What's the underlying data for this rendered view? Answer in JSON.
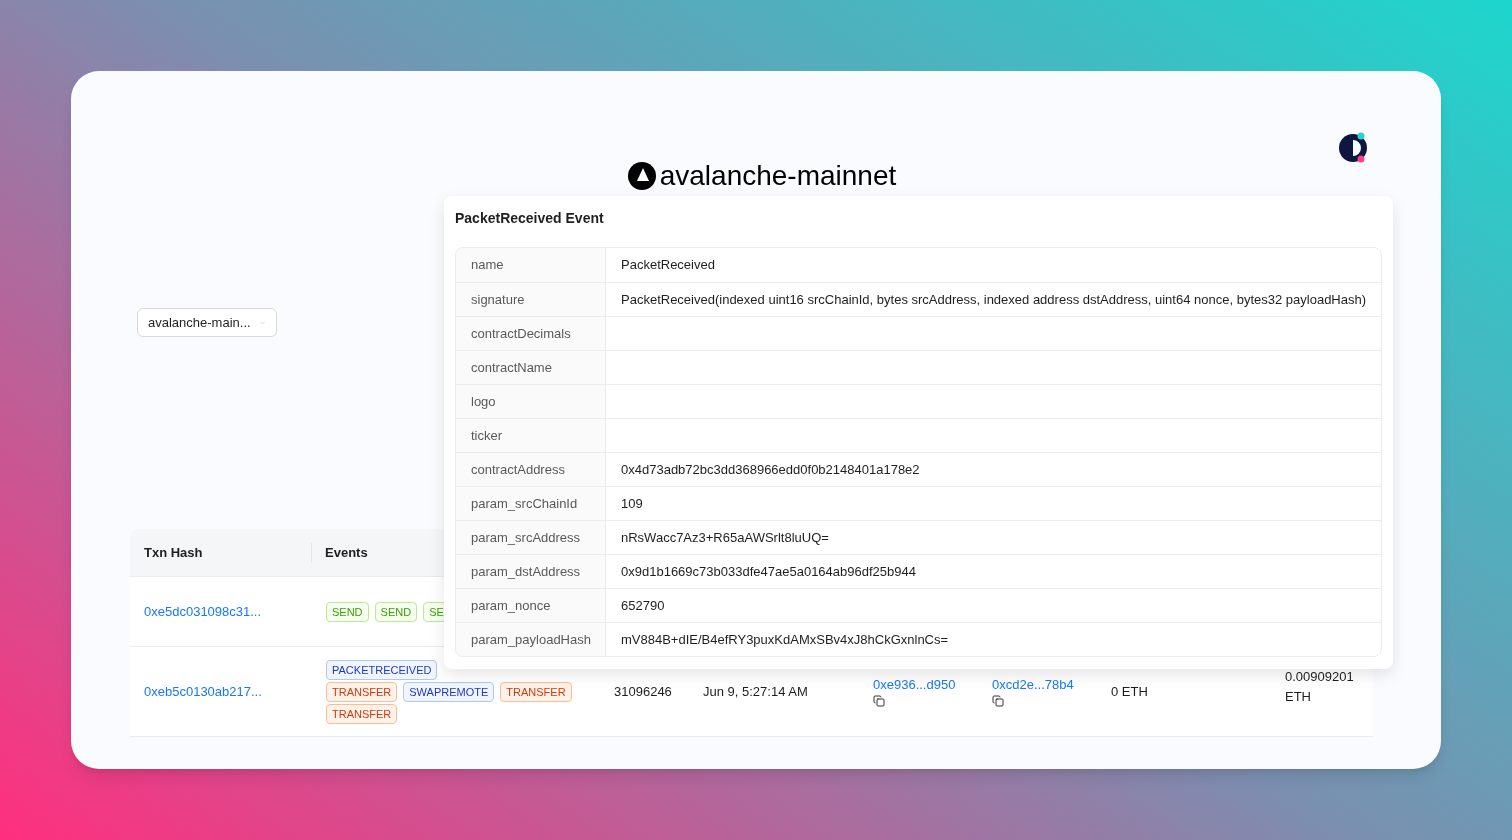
{
  "heading": "avalanche-mainnet",
  "network_select": {
    "value": "avalanche-main..."
  },
  "table": {
    "columns": [
      "Txn Hash",
      "Events"
    ],
    "rows": [
      {
        "txn_hash": "0xe5dc031098c31...",
        "event_lines": [
          [
            {
              "label": "SEND",
              "color": "#389e0d"
            },
            {
              "label": "SEND",
              "color": "#389e0d"
            },
            {
              "label": "SE",
              "color": "#389e0d"
            }
          ]
        ]
      },
      {
        "txn_hash": "0xeb5c0130ab217...",
        "event_lines": [
          [
            {
              "label": "PACKETRECEIVED",
              "color": "#1d39c4"
            }
          ],
          [
            {
              "label": "TRANSFER",
              "color": "#d4380d"
            },
            {
              "label": "SWAPREMOTE",
              "color": "#1d39c4"
            },
            {
              "label": "TRANSFER",
              "color": "#d4380d"
            }
          ],
          [
            {
              "label": "TRANSFER",
              "color": "#d4380d"
            }
          ]
        ],
        "block": "31096246",
        "date": "Jun 9, 5:27:14 AM",
        "from": "0xe936...d950",
        "to": "0xcd2e...78b4",
        "value": "0 ETH",
        "fee": "0.00909201 ETH"
      }
    ]
  },
  "popover": {
    "title": "PacketReceived Event",
    "fields": [
      {
        "key": "name",
        "value": "PacketReceived"
      },
      {
        "key": "signature",
        "value": "PacketReceived(indexed uint16 srcChainId, bytes srcAddress, indexed address dstAddress, uint64 nonce, bytes32 payloadHash)"
      },
      {
        "key": "contractDecimals"
      },
      {
        "key": "contractName"
      },
      {
        "key": "logo"
      },
      {
        "key": "ticker"
      },
      {
        "key": "contractAddress",
        "value": "0x4d73adb72bc3dd368966edd0f0b2148401a178e2"
      },
      {
        "key": "param_srcChainId",
        "value": "109"
      },
      {
        "key": "param_srcAddress",
        "value": "nRsWacc7Az3+R65aAWSrlt8luUQ="
      },
      {
        "key": "param_dstAddress",
        "value": "0x9d1b1669c73b033dfe47ae5a0164ab96df25b944"
      },
      {
        "key": "param_nonce",
        "value": "652790"
      },
      {
        "key": "param_payloadHash",
        "value": "mV884B+dIE/B4efRY3puxKdAMxSBv4xJ8hCkGxnlnCs="
      }
    ]
  }
}
